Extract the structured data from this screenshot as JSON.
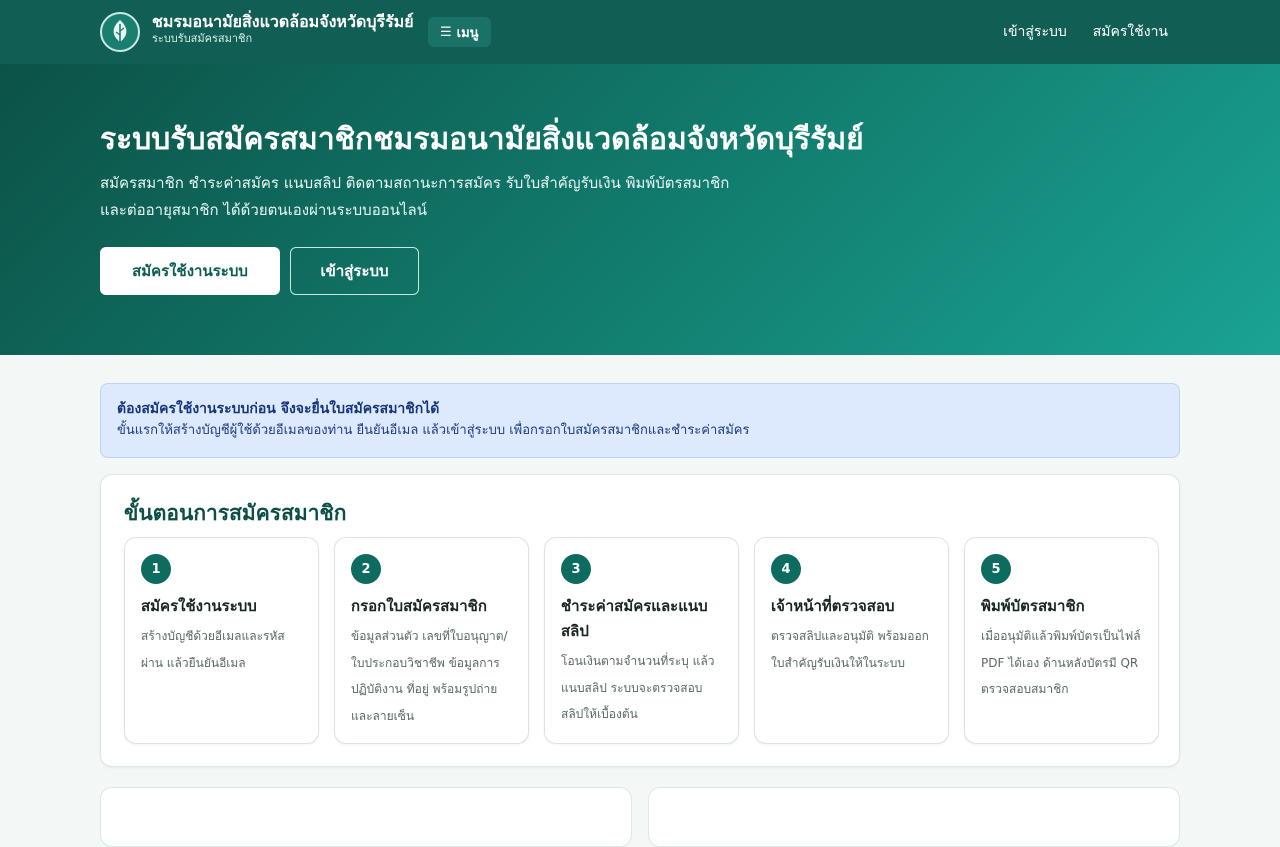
{
  "header": {
    "brand_title": "ชมรมอนามัยสิ่งแวดล้อมจังหวัดบุรีรัมย์",
    "brand_subtitle": "ระบบรับสมัครสมาชิก",
    "menu_label": "เมนู",
    "nav": [
      {
        "label": "เข้าสู่ระบบ"
      },
      {
        "label": "สมัครใช้งาน"
      }
    ]
  },
  "hero": {
    "title": "ระบบรับสมัครสมาชิกชมรมอนามัยสิ่งแวดล้อมจังหวัดบุรีรัมย์",
    "description": "สมัครสมาชิก ชำระค่าสมัคร แนบสลิป ติดตามสถานะการสมัคร รับใบสำคัญรับเงิน พิมพ์บัตรสมาชิก และต่ออายุสมาชิก ได้ด้วยตนเองผ่านระบบออนไลน์",
    "primary_button": "สมัครใช้งานระบบ",
    "secondary_button": "เข้าสู่ระบบ"
  },
  "notice": {
    "title": "ต้องสมัครใช้งานระบบก่อน จึงจะยื่นใบสมัครสมาชิกได้",
    "body": "ขั้นแรกให้สร้างบัญชีผู้ใช้ด้วยอีเมลของท่าน ยืนยันอีเมล แล้วเข้าสู่ระบบ เพื่อกรอกใบสมัครสมาชิกและชำระค่าสมัคร"
  },
  "steps": {
    "heading": "ขั้นตอนการสมัครสมาชิก",
    "items": [
      {
        "number": "1",
        "title": "สมัครใช้งานระบบ",
        "description": "สร้างบัญชีด้วยอีเมลและรหัสผ่าน แล้วยืนยันอีเมล"
      },
      {
        "number": "2",
        "title": "กรอกใบสมัครสมาชิก",
        "description": "ข้อมูลส่วนตัว เลขที่ใบอนุญาต/ใบประกอบวิชาชีพ ข้อมูลการปฏิบัติงาน ที่อยู่ พร้อมรูปถ่ายและลายเซ็น"
      },
      {
        "number": "3",
        "title": "ชำระค่าสมัครและแนบสลิป",
        "description": "โอนเงินตามจำนวนที่ระบุ แล้วแนบสลิป ระบบจะตรวจสอบสลิปให้เบื้องต้น"
      },
      {
        "number": "4",
        "title": "เจ้าหน้าที่ตรวจสอบ",
        "description": "ตรวจสลิปและอนุมัติ พร้อมออกใบสำคัญรับเงินให้ในระบบ"
      },
      {
        "number": "5",
        "title": "พิมพ์บัตรสมาชิก",
        "description": "เมื่ออนุมัติแล้วพิมพ์บัตรเป็นไฟล์ PDF ได้เอง ด้านหลังบัตรมี QR ตรวจสอบสมาชิก"
      }
    ]
  },
  "colors": {
    "brand": "#115e55",
    "accent": "#0e6b5f",
    "notice_bg": "#dde9fd"
  }
}
